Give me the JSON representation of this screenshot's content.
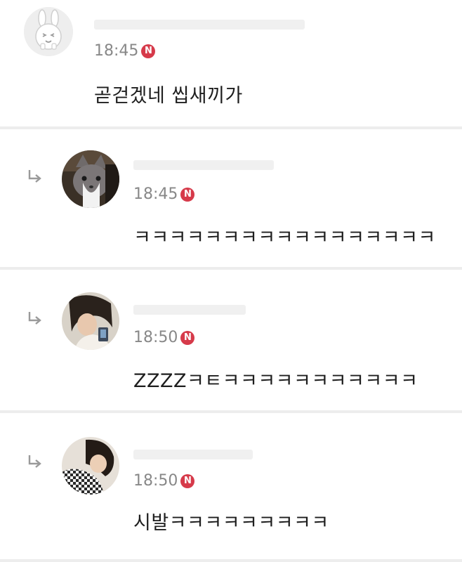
{
  "comments": [
    {
      "id": "c1",
      "is_reply": false,
      "username": "",
      "time": "18:45",
      "badge": "N",
      "text": "곧걷겠네 씹새끼가",
      "avatar_icon": "bunny-avatar-icon"
    },
    {
      "id": "c2",
      "is_reply": true,
      "username": "",
      "time": "18:45",
      "badge": "N",
      "text": "ㅋㅋㅋㅋㅋㅋㅋㅋㅋㅋㅋㅋㅋㅋㅋㅋㅋ",
      "avatar_icon": "cat-photo-avatar"
    },
    {
      "id": "c3",
      "is_reply": true,
      "username": "",
      "time": "18:50",
      "badge": "N",
      "text": "ZZZZㅋㅌㅋㅋㅋㅋㅋㅋㅋㅋㅋㅋㅋ",
      "avatar_icon": "person-photo-avatar"
    },
    {
      "id": "c4",
      "is_reply": true,
      "username": "",
      "time": "18:50",
      "badge": "N",
      "text": "시발ㅋㅋㅋㅋㅋㅋㅋㅋㅋ",
      "avatar_icon": "person-photo-avatar"
    }
  ],
  "colors": {
    "badge": "#d63a4a",
    "time": "#888888",
    "text": "#1e1e1e",
    "divider": "#ededed",
    "reply_arrow": "#9a9a9a"
  }
}
